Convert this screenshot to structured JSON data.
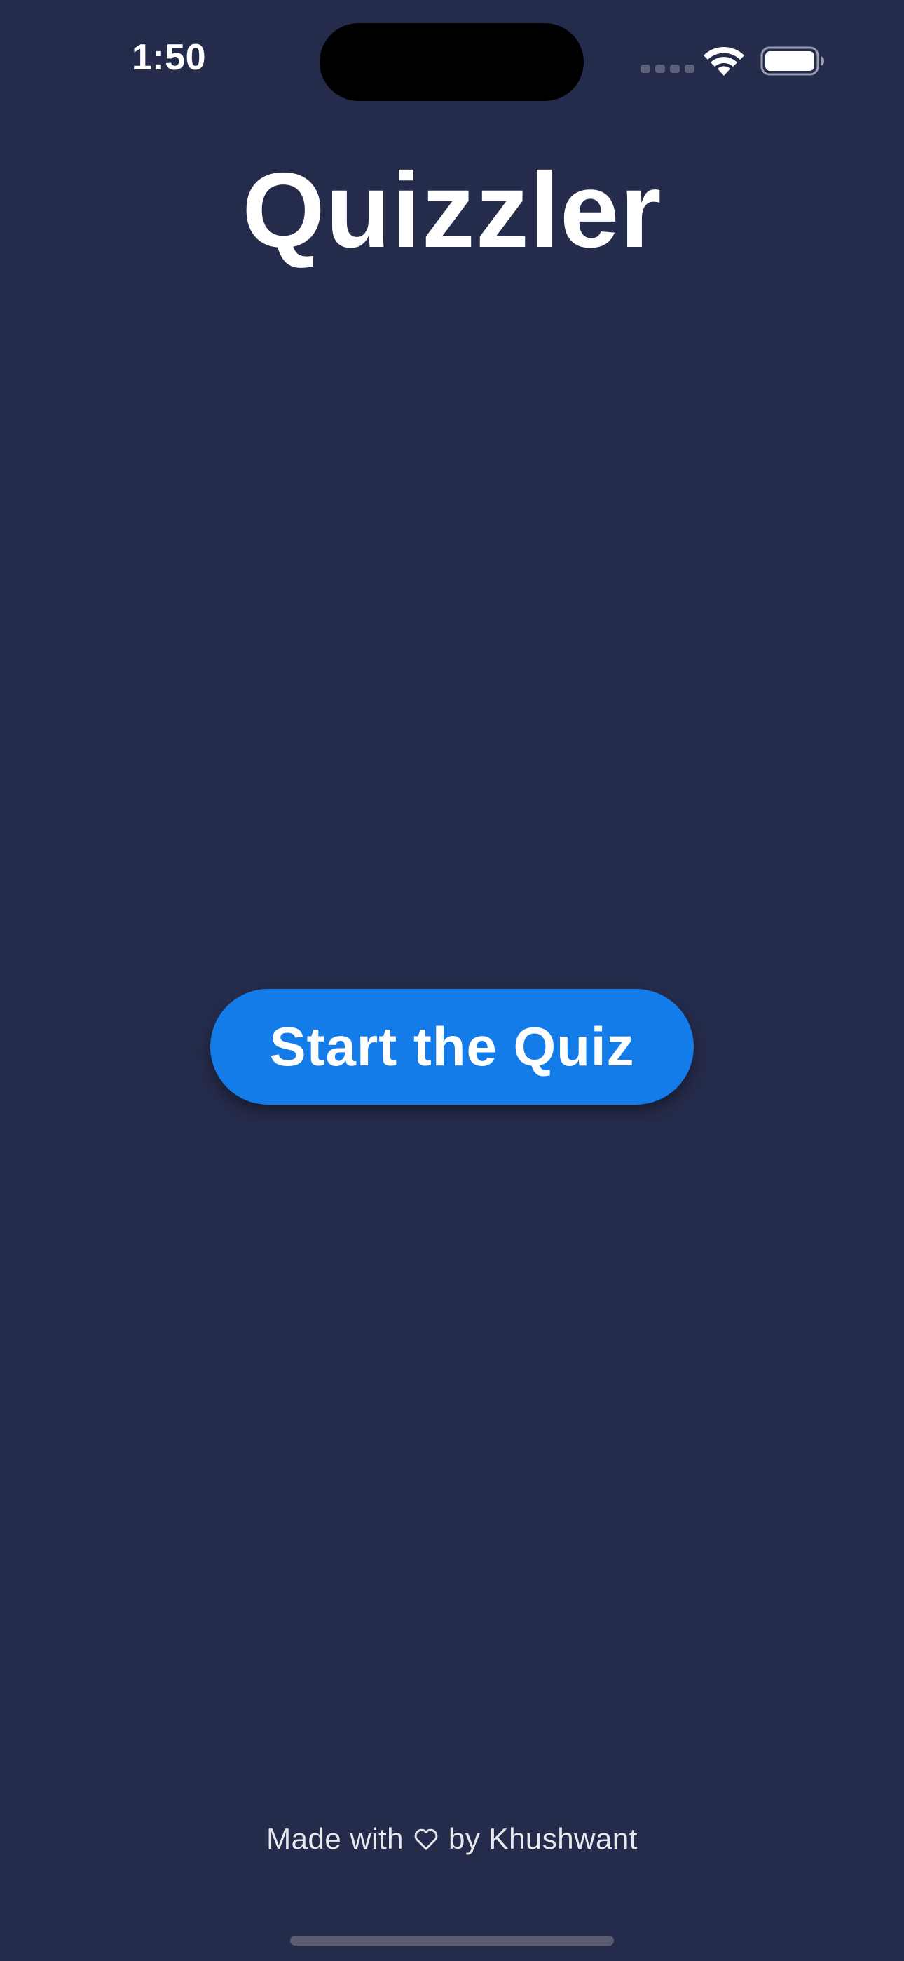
{
  "status_bar": {
    "time": "1:50",
    "icons": [
      "cellular-signal-icon",
      "wifi-icon",
      "battery-icon"
    ]
  },
  "app": {
    "title": "Quizzler"
  },
  "main": {
    "start_button_label": "Start the Quiz"
  },
  "footer": {
    "prefix": "Made with",
    "heart_icon": "heart-outline-icon",
    "suffix": "by Khushwant"
  },
  "colors": {
    "background": "#252b4a",
    "button": "#137ce8",
    "text": "#ffffff"
  }
}
